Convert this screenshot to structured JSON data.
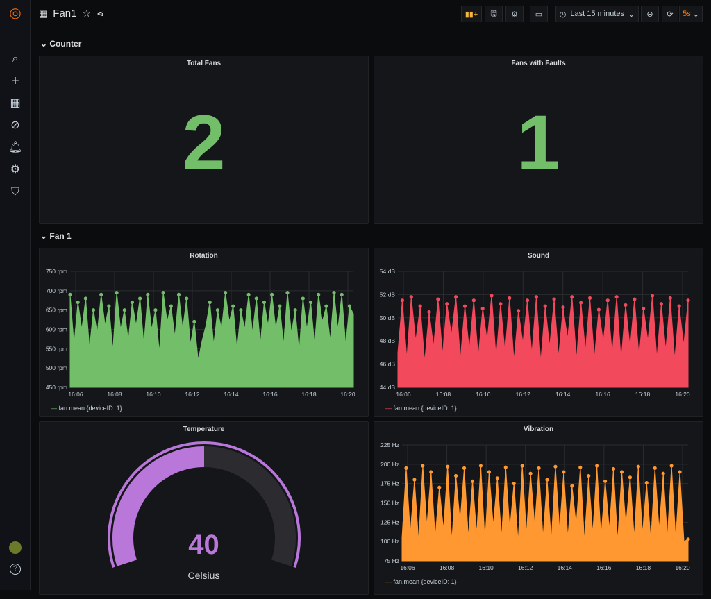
{
  "header": {
    "title": "Fan1",
    "time_range": "Last 15 minutes",
    "refresh": "5s"
  },
  "sidebar": {
    "icons": [
      "grafana-logo",
      "search-icon",
      "plus-icon",
      "dashboards-icon",
      "explore-icon",
      "alert-bell-icon",
      "gear-icon",
      "shield-icon",
      "avatar",
      "help-icon"
    ]
  },
  "rows": {
    "counter": "Counter",
    "fan1": "Fan 1"
  },
  "stats": {
    "total_fans": {
      "title": "Total Fans",
      "value": "2"
    },
    "faults": {
      "title": "Fans with Faults",
      "value": "1"
    },
    "color": "#73bf69"
  },
  "gauge": {
    "title": "Temperature",
    "value": "40",
    "unit": "Celsius",
    "fill_fraction": 0.5,
    "color": "#b877d9"
  },
  "chart_data": [
    {
      "type": "area",
      "title": "Rotation",
      "ylim": [
        450,
        750
      ],
      "yticks": [
        "750 rpm",
        "700 rpm",
        "650 rpm",
        "600 rpm",
        "550 rpm",
        "500 rpm",
        "450 rpm"
      ],
      "xticks": [
        "16:06",
        "16:08",
        "16:10",
        "16:12",
        "16:14",
        "16:16",
        "16:18",
        "16:20"
      ],
      "legend": "fan.mean {deviceID: 1}",
      "color": "#73bf69",
      "values": [
        690,
        560,
        670,
        600,
        680,
        550,
        650,
        590,
        690,
        610,
        660,
        545,
        695,
        600,
        650,
        570,
        670,
        610,
        680,
        560,
        690,
        600,
        650,
        540,
        695,
        620,
        660,
        580,
        690,
        600,
        680,
        560,
        620,
        520,
        570,
        610,
        670,
        560,
        650,
        600,
        695,
        620,
        660,
        545,
        650,
        600,
        690,
        590,
        680,
        560,
        670,
        610,
        690,
        600,
        660,
        560,
        695,
        590,
        650,
        540,
        680,
        600,
        670,
        560,
        690,
        620,
        660,
        570,
        695,
        600,
        690,
        560,
        660,
        640
      ]
    },
    {
      "type": "area",
      "title": "Sound",
      "ylim": [
        44,
        54
      ],
      "yticks": [
        "54 dB",
        "52 dB",
        "50 dB",
        "48 dB",
        "46 dB",
        "44 dB"
      ],
      "xticks": [
        "16:06",
        "16:08",
        "16:10",
        "16:12",
        "16:14",
        "16:16",
        "16:18",
        "16:20"
      ],
      "legend": "fan.mean {deviceID: 1}",
      "color": "#f2495c",
      "values": [
        47,
        51.5,
        46.5,
        51.8,
        48,
        51,
        46.2,
        50.5,
        47.5,
        51.6,
        46.8,
        51.2,
        48.5,
        51.8,
        46.4,
        51,
        47.2,
        51.5,
        46.6,
        50.8,
        48,
        51.9,
        46.5,
        51.2,
        47,
        51.7,
        46.3,
        50.6,
        47.8,
        51.5,
        46.9,
        51.8,
        46.2,
        51,
        47.5,
        51.6,
        46.6,
        50.9,
        48.2,
        51.8,
        46.4,
        51.3,
        47.1,
        51.7,
        46.5,
        50.7,
        47.9,
        51.5,
        46.8,
        51.8,
        46.3,
        51.1,
        47.4,
        51.6,
        46.6,
        50.8,
        48,
        51.9,
        46.5,
        51.2,
        47.2,
        51.7,
        46.4,
        51,
        47.6,
        51.5
      ]
    },
    {
      "type": "area",
      "title": "Vibration",
      "ylim": [
        75,
        225
      ],
      "yticks": [
        "225 Hz",
        "200 Hz",
        "175 Hz",
        "150 Hz",
        "125 Hz",
        "100 Hz",
        "75 Hz"
      ],
      "xticks": [
        "16:06",
        "16:08",
        "16:10",
        "16:12",
        "16:14",
        "16:16",
        "16:18",
        "16:20"
      ],
      "legend": "fan.mean {deviceID: 1}",
      "color": "#ff9830",
      "values": [
        105,
        195,
        110,
        180,
        100,
        198,
        120,
        190,
        105,
        170,
        115,
        197,
        100,
        185,
        125,
        195,
        105,
        178,
        110,
        198,
        100,
        190,
        120,
        182,
        105,
        196,
        115,
        175,
        100,
        198,
        110,
        188,
        120,
        195,
        105,
        180,
        100,
        197,
        115,
        190,
        105,
        172,
        120,
        196,
        100,
        185,
        110,
        198,
        105,
        178,
        115,
        194,
        100,
        190,
        120,
        183,
        105,
        197,
        110,
        176,
        100,
        195,
        115,
        188,
        105,
        198,
        102,
        190,
        100,
        103
      ]
    }
  ]
}
